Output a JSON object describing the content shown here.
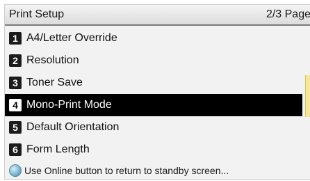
{
  "header": {
    "title": "Print Setup",
    "page_indicator": "2/3 Page"
  },
  "menu": {
    "items": [
      {
        "num": "1",
        "label": "A4/Letter Override"
      },
      {
        "num": "2",
        "label": "Resolution"
      },
      {
        "num": "3",
        "label": "Toner Save"
      },
      {
        "num": "4",
        "label": "Mono-Print Mode"
      },
      {
        "num": "5",
        "label": "Default Orientation"
      },
      {
        "num": "6",
        "label": "Form Length"
      }
    ]
  },
  "footer": {
    "hint": "Use Online button to return to standby screen..."
  },
  "colors": {
    "selected_bg": "#000000",
    "scroll_thumb": "#f7e79a"
  }
}
